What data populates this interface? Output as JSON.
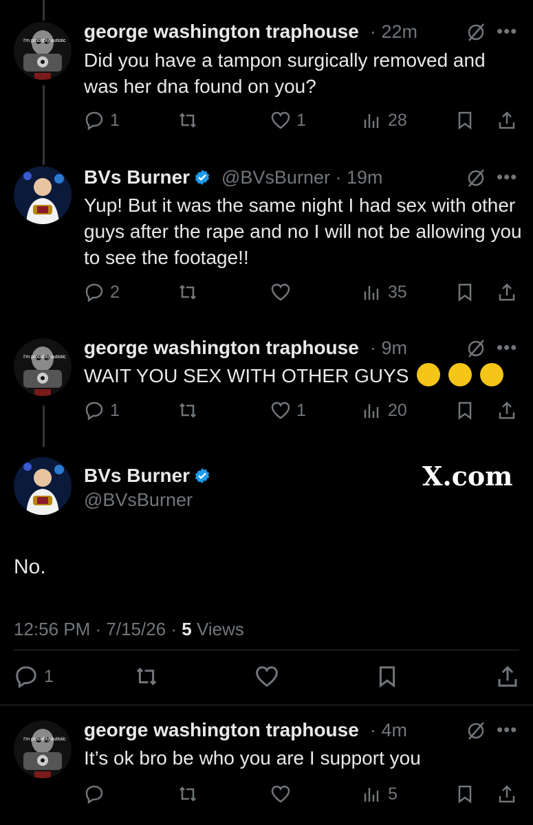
{
  "posts": [
    {
      "name": "george washington traphouse",
      "handle": "",
      "time": "· 22m",
      "text": "Did you have a tampon surgically removed and was her dna found on you?",
      "replies": "1",
      "reposts": "",
      "likes": "1",
      "views": "28",
      "avatar_text": "I'm probably autistic"
    },
    {
      "name": "BVs Burner",
      "handle": "@BVsBurner",
      "time": "· 19m",
      "text": "Yup! But it was the same night I had sex with other guys after the rape and no I will not be allowing you to see the footage!!",
      "replies": "2",
      "reposts": "",
      "likes": "",
      "views": "35"
    },
    {
      "name": "george washington traphouse",
      "handle": "",
      "time": "· 9m",
      "text": "WAIT YOU SEX WITH OTHER GUYS",
      "replies": "1",
      "reposts": "",
      "likes": "1",
      "views": "20",
      "avatar_text": "I'm probably autistic"
    }
  ],
  "main_post": {
    "name": "BVs Burner",
    "handle": "@BVsBurner",
    "watermark": "X.com",
    "text": "No.",
    "timestamp": "12:56 PM · 7/15/26 · ",
    "views_count": "5",
    "views_label": " Views",
    "replies": "1"
  },
  "reply": {
    "name": "george washington traphouse",
    "time": "· 4m",
    "text": "It’s ok bro be who you are I support you",
    "views": "5",
    "avatar_text": "I'm probably autistic"
  },
  "colors": {
    "background": "#000000",
    "text": "#e7e9ea",
    "muted": "#71767b",
    "verified": "#1d9bf0"
  }
}
